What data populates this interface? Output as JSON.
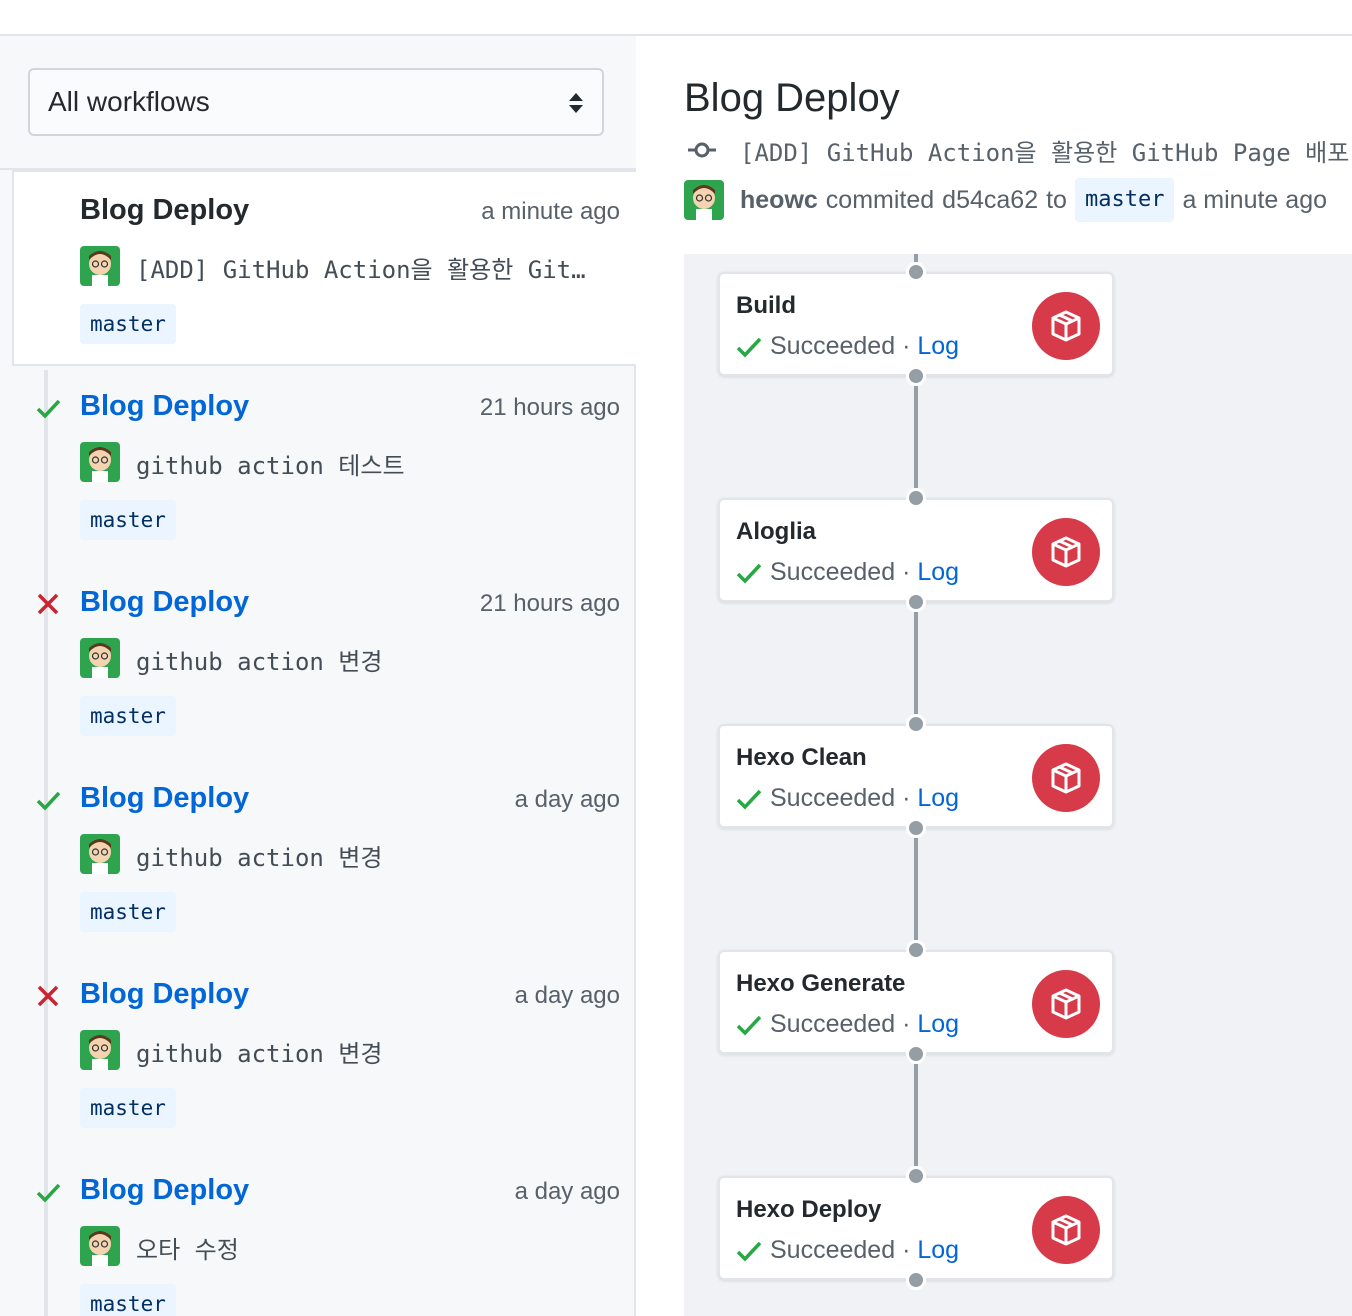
{
  "sidebar": {
    "filter": {
      "selected": "All workflows"
    },
    "runs": [
      {
        "status": "in-progress",
        "title": "Blog Deploy",
        "time": "a minute ago",
        "message": "[ADD] GitHub Action을 활용한 GitH…",
        "branch": "master"
      },
      {
        "status": "success",
        "title": "Blog Deploy",
        "time": "21 hours ago",
        "message": "github action 테스트",
        "branch": "master"
      },
      {
        "status": "failure",
        "title": "Blog Deploy",
        "time": "21 hours ago",
        "message": "github action 변경",
        "branch": "master"
      },
      {
        "status": "success",
        "title": "Blog Deploy",
        "time": "a day ago",
        "message": "github action 변경",
        "branch": "master"
      },
      {
        "status": "failure",
        "title": "Blog Deploy",
        "time": "a day ago",
        "message": "github action 변경",
        "branch": "master"
      },
      {
        "status": "success",
        "title": "Blog Deploy",
        "time": "a day ago",
        "message": "오타 수정",
        "branch": "master"
      }
    ]
  },
  "main": {
    "title": "Blog Deploy",
    "commit_message": "[ADD] GitHub Action을 활용한 GitHub Page 배포",
    "author": "heowc",
    "commit_verb": "commited",
    "sha": "d54ca62",
    "to_word": "to",
    "branch": "master",
    "time": "a minute ago",
    "jobs": [
      {
        "name": "Build",
        "status": "Succeeded",
        "sep": "·",
        "log": "Log"
      },
      {
        "name": "Aloglia",
        "status": "Succeeded",
        "sep": "·",
        "log": "Log"
      },
      {
        "name": "Hexo Clean",
        "status": "Succeeded",
        "sep": "·",
        "log": "Log"
      },
      {
        "name": "Hexo Generate",
        "status": "Succeeded",
        "sep": "·",
        "log": "Log"
      },
      {
        "name": "Hexo Deploy",
        "status": "Succeeded",
        "sep": "·",
        "log": "Log"
      }
    ]
  },
  "colors": {
    "link": "#0366d6",
    "success": "#28a745",
    "failure": "#cb2431",
    "action_icon_bg": "#d73a49"
  },
  "icons": {
    "success": "check-icon",
    "failure": "x-icon",
    "commit": "git-commit-icon",
    "job": "package-icon",
    "select": "select-arrows-icon"
  }
}
